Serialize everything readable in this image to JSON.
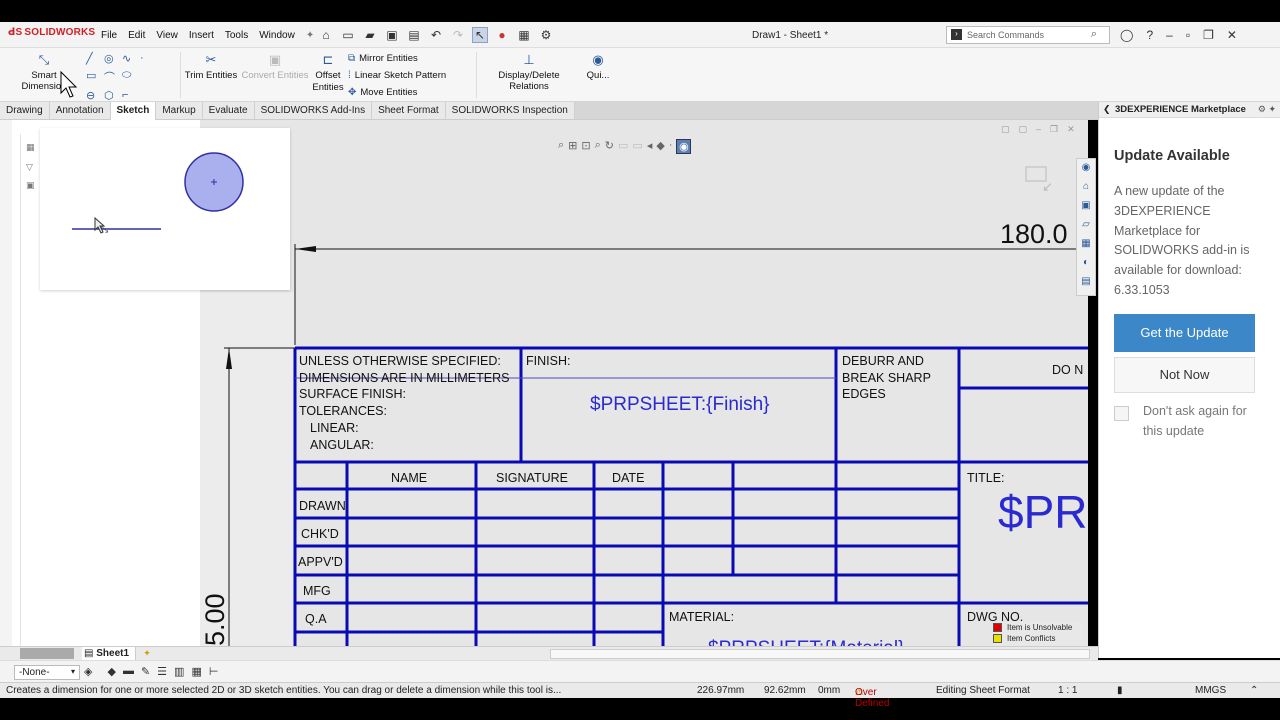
{
  "app": {
    "logo": "SOLIDWORKS",
    "menus": [
      "File",
      "Edit",
      "View",
      "Insert",
      "Tools",
      "Window"
    ],
    "document_title": "Draw1 - Sheet1 *",
    "search_placeholder": "Search Commands"
  },
  "ribbon": {
    "smart_dimension": "Smart Dimension",
    "trim_entities": "Trim Entities",
    "convert_entities": "Convert Entities",
    "offset_entities": "Offset Entities",
    "mirror_entities": "Mirror Entities",
    "linear_sketch_pattern": "Linear Sketch Pattern",
    "move_entities": "Move Entities",
    "display_delete_relations": "Display/Delete Relations",
    "quick": "Qui..."
  },
  "tabs": [
    {
      "label": "Drawing",
      "active": false
    },
    {
      "label": "Annotation",
      "active": false
    },
    {
      "label": "Sketch",
      "active": true
    },
    {
      "label": "Markup",
      "active": false
    },
    {
      "label": "Evaluate",
      "active": false
    },
    {
      "label": "SOLIDWORKS Add-Ins",
      "active": false
    },
    {
      "label": "Sheet Format",
      "active": false
    },
    {
      "label": "SOLIDWORKS Inspection",
      "active": false
    }
  ],
  "drawing": {
    "dimension_top": "180.0",
    "dimension_left": "5.00",
    "title_block": {
      "notes": [
        "UNLESS OTHERWISE SPECIFIED:",
        "DIMENSIONS ARE IN MILLIMETERS",
        "SURFACE FINISH:",
        "TOLERANCES:",
        "LINEAR:",
        "ANGULAR:"
      ],
      "finish_label": "FINISH:",
      "finish_value": "$PRPSHEET:{Finish}",
      "deburr": [
        "DEBURR AND",
        "BREAK SHARP",
        "EDGES"
      ],
      "do_not": "DO N",
      "headers": [
        "NAME",
        "SIGNATURE",
        "DATE"
      ],
      "rows": [
        "DRAWN",
        "CHK'D",
        "APPV'D",
        "MFG",
        "Q.A"
      ],
      "title_label": "TITLE:",
      "title_value": "$PR",
      "material_label": "MATERIAL:",
      "material_value": "$PRPSHEET:{Material}",
      "dwg_no_label": "DWG NO."
    },
    "legend": [
      {
        "label": "Item is Unsolvable",
        "color": "#e00000"
      },
      {
        "label": "Item Conflicts",
        "color": "#e8e000"
      }
    ]
  },
  "taskpane": {
    "header": "3DEXPERIENCE Marketplace",
    "title": "Update Available",
    "message": "A new update of the 3DEXPERIENCE Marketplace for SOLIDWORKS add-in is available for download: 6.33.1053",
    "primary_button": "Get the Update",
    "secondary_button": "Not Now",
    "checkbox_label": "Don't ask again for this update"
  },
  "sheet_tab": "Sheet1",
  "layer": "-None-",
  "status": {
    "hint": "Creates a dimension for one or more selected 2D or 3D sketch entities. You can drag or delete a dimension while this tool is...",
    "x": "226.97mm",
    "y": "92.62mm",
    "z": "0mm",
    "state": "Over Defined",
    "mode": "Editing Sheet Format",
    "scale": "1 : 1",
    "units": "MMGS"
  },
  "colors": {
    "accent": "#3b87c7",
    "drawing_line": "#0a0ab4",
    "property_text": "#2a2ad0",
    "warning": "#b00000"
  }
}
